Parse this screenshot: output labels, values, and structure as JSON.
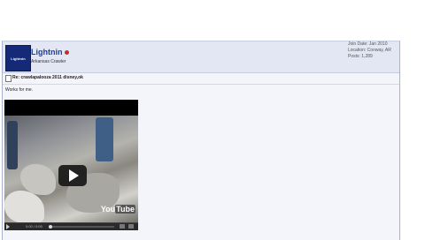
{
  "user": {
    "avatar_text": "Lightnin",
    "name": "Lightnin",
    "title": "Arkansas Crawler",
    "join_date": "Join Date: Jan 2010",
    "location": "Location: Conway, AR",
    "posts": "Posts: 1,289",
    "online_color": "#c92a2a"
  },
  "post": {
    "title": "Re: crawlapalooza 2011 disney,ok",
    "body": "Works for me."
  },
  "video": {
    "logo_you": "You",
    "logo_tube": "Tube",
    "time": "0:00 / 0:00",
    "play_icon": "play-icon"
  }
}
